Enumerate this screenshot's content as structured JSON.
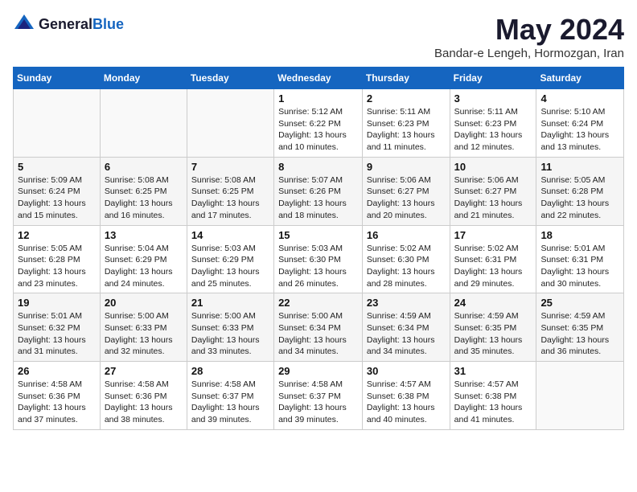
{
  "header": {
    "logo_general": "General",
    "logo_blue": "Blue",
    "month": "May 2024",
    "location": "Bandar-e Lengeh, Hormozgan, Iran"
  },
  "weekdays": [
    "Sunday",
    "Monday",
    "Tuesday",
    "Wednesday",
    "Thursday",
    "Friday",
    "Saturday"
  ],
  "weeks": [
    [
      {
        "day": "",
        "sunrise": "",
        "sunset": "",
        "daylight": ""
      },
      {
        "day": "",
        "sunrise": "",
        "sunset": "",
        "daylight": ""
      },
      {
        "day": "",
        "sunrise": "",
        "sunset": "",
        "daylight": ""
      },
      {
        "day": "1",
        "sunrise": "Sunrise: 5:12 AM",
        "sunset": "Sunset: 6:22 PM",
        "daylight": "Daylight: 13 hours and 10 minutes."
      },
      {
        "day": "2",
        "sunrise": "Sunrise: 5:11 AM",
        "sunset": "Sunset: 6:23 PM",
        "daylight": "Daylight: 13 hours and 11 minutes."
      },
      {
        "day": "3",
        "sunrise": "Sunrise: 5:11 AM",
        "sunset": "Sunset: 6:23 PM",
        "daylight": "Daylight: 13 hours and 12 minutes."
      },
      {
        "day": "4",
        "sunrise": "Sunrise: 5:10 AM",
        "sunset": "Sunset: 6:24 PM",
        "daylight": "Daylight: 13 hours and 13 minutes."
      }
    ],
    [
      {
        "day": "5",
        "sunrise": "Sunrise: 5:09 AM",
        "sunset": "Sunset: 6:24 PM",
        "daylight": "Daylight: 13 hours and 15 minutes."
      },
      {
        "day": "6",
        "sunrise": "Sunrise: 5:08 AM",
        "sunset": "Sunset: 6:25 PM",
        "daylight": "Daylight: 13 hours and 16 minutes."
      },
      {
        "day": "7",
        "sunrise": "Sunrise: 5:08 AM",
        "sunset": "Sunset: 6:25 PM",
        "daylight": "Daylight: 13 hours and 17 minutes."
      },
      {
        "day": "8",
        "sunrise": "Sunrise: 5:07 AM",
        "sunset": "Sunset: 6:26 PM",
        "daylight": "Daylight: 13 hours and 18 minutes."
      },
      {
        "day": "9",
        "sunrise": "Sunrise: 5:06 AM",
        "sunset": "Sunset: 6:27 PM",
        "daylight": "Daylight: 13 hours and 20 minutes."
      },
      {
        "day": "10",
        "sunrise": "Sunrise: 5:06 AM",
        "sunset": "Sunset: 6:27 PM",
        "daylight": "Daylight: 13 hours and 21 minutes."
      },
      {
        "day": "11",
        "sunrise": "Sunrise: 5:05 AM",
        "sunset": "Sunset: 6:28 PM",
        "daylight": "Daylight: 13 hours and 22 minutes."
      }
    ],
    [
      {
        "day": "12",
        "sunrise": "Sunrise: 5:05 AM",
        "sunset": "Sunset: 6:28 PM",
        "daylight": "Daylight: 13 hours and 23 minutes."
      },
      {
        "day": "13",
        "sunrise": "Sunrise: 5:04 AM",
        "sunset": "Sunset: 6:29 PM",
        "daylight": "Daylight: 13 hours and 24 minutes."
      },
      {
        "day": "14",
        "sunrise": "Sunrise: 5:03 AM",
        "sunset": "Sunset: 6:29 PM",
        "daylight": "Daylight: 13 hours and 25 minutes."
      },
      {
        "day": "15",
        "sunrise": "Sunrise: 5:03 AM",
        "sunset": "Sunset: 6:30 PM",
        "daylight": "Daylight: 13 hours and 26 minutes."
      },
      {
        "day": "16",
        "sunrise": "Sunrise: 5:02 AM",
        "sunset": "Sunset: 6:30 PM",
        "daylight": "Daylight: 13 hours and 28 minutes."
      },
      {
        "day": "17",
        "sunrise": "Sunrise: 5:02 AM",
        "sunset": "Sunset: 6:31 PM",
        "daylight": "Daylight: 13 hours and 29 minutes."
      },
      {
        "day": "18",
        "sunrise": "Sunrise: 5:01 AM",
        "sunset": "Sunset: 6:31 PM",
        "daylight": "Daylight: 13 hours and 30 minutes."
      }
    ],
    [
      {
        "day": "19",
        "sunrise": "Sunrise: 5:01 AM",
        "sunset": "Sunset: 6:32 PM",
        "daylight": "Daylight: 13 hours and 31 minutes."
      },
      {
        "day": "20",
        "sunrise": "Sunrise: 5:00 AM",
        "sunset": "Sunset: 6:33 PM",
        "daylight": "Daylight: 13 hours and 32 minutes."
      },
      {
        "day": "21",
        "sunrise": "Sunrise: 5:00 AM",
        "sunset": "Sunset: 6:33 PM",
        "daylight": "Daylight: 13 hours and 33 minutes."
      },
      {
        "day": "22",
        "sunrise": "Sunrise: 5:00 AM",
        "sunset": "Sunset: 6:34 PM",
        "daylight": "Daylight: 13 hours and 34 minutes."
      },
      {
        "day": "23",
        "sunrise": "Sunrise: 4:59 AM",
        "sunset": "Sunset: 6:34 PM",
        "daylight": "Daylight: 13 hours and 34 minutes."
      },
      {
        "day": "24",
        "sunrise": "Sunrise: 4:59 AM",
        "sunset": "Sunset: 6:35 PM",
        "daylight": "Daylight: 13 hours and 35 minutes."
      },
      {
        "day": "25",
        "sunrise": "Sunrise: 4:59 AM",
        "sunset": "Sunset: 6:35 PM",
        "daylight": "Daylight: 13 hours and 36 minutes."
      }
    ],
    [
      {
        "day": "26",
        "sunrise": "Sunrise: 4:58 AM",
        "sunset": "Sunset: 6:36 PM",
        "daylight": "Daylight: 13 hours and 37 minutes."
      },
      {
        "day": "27",
        "sunrise": "Sunrise: 4:58 AM",
        "sunset": "Sunset: 6:36 PM",
        "daylight": "Daylight: 13 hours and 38 minutes."
      },
      {
        "day": "28",
        "sunrise": "Sunrise: 4:58 AM",
        "sunset": "Sunset: 6:37 PM",
        "daylight": "Daylight: 13 hours and 39 minutes."
      },
      {
        "day": "29",
        "sunrise": "Sunrise: 4:58 AM",
        "sunset": "Sunset: 6:37 PM",
        "daylight": "Daylight: 13 hours and 39 minutes."
      },
      {
        "day": "30",
        "sunrise": "Sunrise: 4:57 AM",
        "sunset": "Sunset: 6:38 PM",
        "daylight": "Daylight: 13 hours and 40 minutes."
      },
      {
        "day": "31",
        "sunrise": "Sunrise: 4:57 AM",
        "sunset": "Sunset: 6:38 PM",
        "daylight": "Daylight: 13 hours and 41 minutes."
      },
      {
        "day": "",
        "sunrise": "",
        "sunset": "",
        "daylight": ""
      }
    ]
  ]
}
